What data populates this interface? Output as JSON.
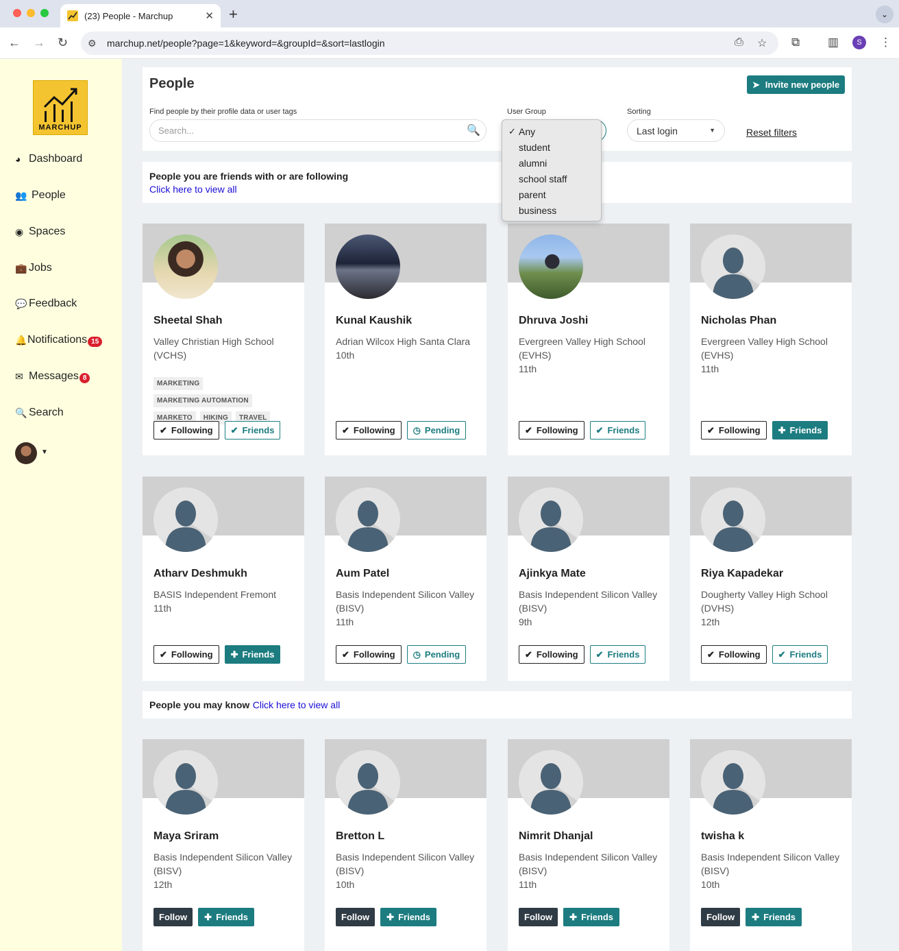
{
  "browser": {
    "tab_title": "(23) People - Marchup",
    "url": "marchup.net/people?page=1&keyword=&groupId=&sort=lastlogin",
    "profile_initial": "S"
  },
  "sidebar": {
    "logo_text": "MARCHUP",
    "items": [
      {
        "label": "Dashboard",
        "icon": "dashboard-icon"
      },
      {
        "label": "People",
        "icon": "users-icon"
      },
      {
        "label": "Spaces",
        "icon": "circle-icon"
      },
      {
        "label": "Jobs",
        "icon": "briefcase-icon"
      },
      {
        "label": "Feedback",
        "icon": "comment-icon"
      },
      {
        "label": "Notifications",
        "icon": "bell-icon",
        "badge": "15"
      },
      {
        "label": "Messages",
        "icon": "envelope-icon",
        "badge": "8"
      },
      {
        "label": "Search",
        "icon": "search-icon"
      }
    ]
  },
  "header": {
    "title": "People",
    "invite_label": "Invite new people",
    "search_label": "Find people by their profile data or user tags",
    "search_placeholder": "Search...",
    "group_label": "User Group",
    "sort_label": "Sorting",
    "sort_value": "Last login",
    "reset_label": "Reset filters"
  },
  "group_dropdown": {
    "options": [
      "Any",
      "student",
      "alumni",
      "school staff",
      "parent",
      "business"
    ],
    "selected": "Any"
  },
  "friends_section": {
    "title": "People you are friends with or are following",
    "link": "Click here to view all"
  },
  "friends_cards": [
    {
      "name": "Sheetal Shah",
      "school": "Valley Christian High School (VCHS)",
      "grade": "",
      "tags": [
        "MARKETING",
        "MARKETING AUTOMATION",
        "MARKETO",
        "HIKING",
        "TRAVEL"
      ],
      "follow": "Following",
      "friend": "Friends",
      "friend_style": "outline"
    },
    {
      "name": "Kunal Kaushik",
      "school": "Adrian Wilcox High Santa Clara",
      "grade": "10th",
      "tags": [],
      "follow": "Following",
      "friend": "Pending",
      "friend_style": "pending"
    },
    {
      "name": "Dhruva Joshi",
      "school": "Evergreen Valley High School (EVHS)",
      "grade": "11th",
      "tags": [],
      "follow": "Following",
      "friend": "Friends",
      "friend_style": "outline"
    },
    {
      "name": "Nicholas Phan",
      "school": "Evergreen Valley High School (EVHS)",
      "grade": "11th",
      "tags": [],
      "follow": "Following",
      "friend": "Friends",
      "friend_style": "filled"
    },
    {
      "name": "Atharv Deshmukh",
      "school": "BASIS Independent Fremont",
      "grade": "11th",
      "tags": [],
      "follow": "Following",
      "friend": "Friends",
      "friend_style": "filled"
    },
    {
      "name": "Aum Patel",
      "school": "Basis Independent Silicon Valley (BISV)",
      "grade": "11th",
      "tags": [],
      "follow": "Following",
      "friend": "Pending",
      "friend_style": "pending"
    },
    {
      "name": "Ajinkya Mate",
      "school": "Basis Independent Silicon Valley (BISV)",
      "grade": "9th",
      "tags": [],
      "follow": "Following",
      "friend": "Friends",
      "friend_style": "outline"
    },
    {
      "name": "Riya Kapadekar",
      "school": "Dougherty Valley High School (DVHS)",
      "grade": "12th",
      "tags": [],
      "follow": "Following",
      "friend": "Friends",
      "friend_style": "outline"
    }
  ],
  "know_section": {
    "title": "People you may know",
    "link": "Click here to view all"
  },
  "know_cards": [
    {
      "name": "Maya Sriram",
      "school": "Basis Independent Silicon Valley (BISV)",
      "grade": "12th",
      "follow": "Follow",
      "friend": "Friends"
    },
    {
      "name": "Bretton L",
      "school": "Basis Independent Silicon Valley (BISV)",
      "grade": "10th",
      "follow": "Follow",
      "friend": "Friends"
    },
    {
      "name": "Nimrit Dhanjal",
      "school": "Basis Independent Silicon Valley (BISV)",
      "grade": "11th",
      "follow": "Follow",
      "friend": "Friends"
    },
    {
      "name": "twisha k",
      "school": "Basis Independent Silicon Valley (BISV)",
      "grade": "10th",
      "follow": "Follow",
      "friend": "Friends"
    }
  ],
  "colors": {
    "accent": "#1c7c80",
    "sidebar_bg": "#ffffe0",
    "badge": "#d9202d",
    "logo": "#f4c430"
  }
}
